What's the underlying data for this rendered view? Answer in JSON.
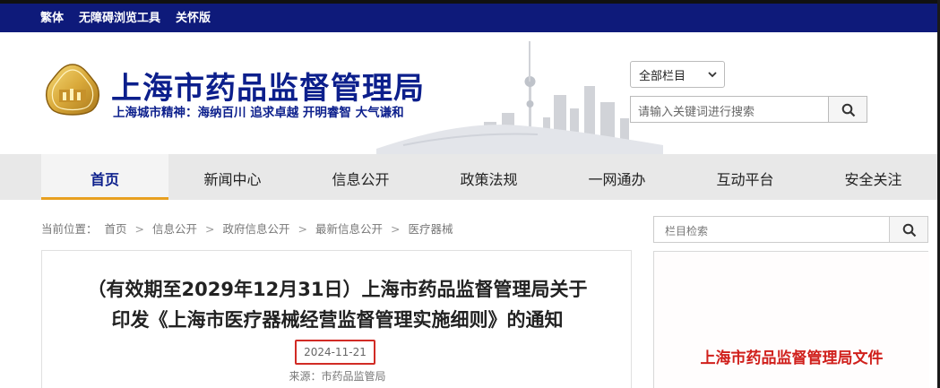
{
  "topbar": {
    "links": [
      "繁体",
      "无障碍浏览工具",
      "关怀版"
    ]
  },
  "header": {
    "title": "上海市药品监督管理局",
    "slogan": "上海城市精神：海纳百川  追求卓越  开明睿智  大气谦和",
    "scope_select": "全部栏目",
    "search_placeholder": "请输入关键词进行搜索"
  },
  "nav": {
    "items": [
      "首页",
      "新闻中心",
      "信息公开",
      "政策法规",
      "一网通办",
      "互动平台",
      "安全关注"
    ],
    "active": "首页"
  },
  "breadcrumb": {
    "label": "当前位置：",
    "items": [
      "首页",
      "信息公开",
      "政府信息公开",
      "最新信息公开",
      "医疗器械"
    ]
  },
  "article": {
    "title_line1": "（有效期至2029年12月31日）上海市药品监督管理局关于",
    "title_line2": "印发《上海市医疗器械经营监督管理实施细则》的通知",
    "date": "2024-11-21",
    "source": "来源：市药品监管局"
  },
  "sidebar": {
    "search_placeholder": "栏目检索",
    "doc_caption": "上海市药品监督管理局文件"
  },
  "colors": {
    "brand_blue": "#0c1f8c",
    "topbar_bg": "#0e1a7a",
    "highlight_red": "#d12b25",
    "nav_underline": "#e8a020"
  },
  "icons": [
    "logo-emblem-icon",
    "chevron-down-icon",
    "search-icon"
  ]
}
